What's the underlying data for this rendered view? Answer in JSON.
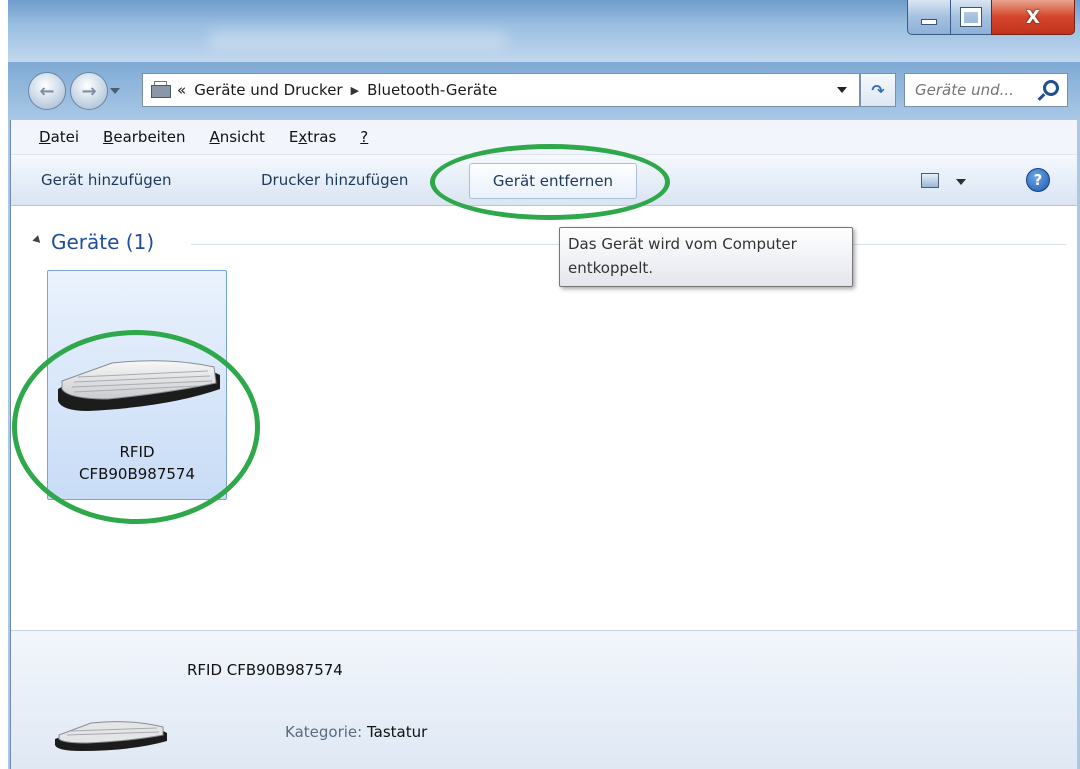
{
  "window": {
    "buttons": {
      "minimize": "minimize",
      "maximize": "maximize",
      "close": "X"
    }
  },
  "address_bar": {
    "prefix": "«",
    "breadcrumbs": [
      "Geräte und Drucker",
      "Bluetooth-Geräte"
    ],
    "search_placeholder": "Geräte und..."
  },
  "menu": {
    "items": [
      {
        "label": "Datei",
        "accel": "D",
        "rest": "atei"
      },
      {
        "label": "Bearbeiten",
        "accel": "B",
        "rest": "earbeiten"
      },
      {
        "label": "Ansicht",
        "accel": "A",
        "rest": "nsicht"
      },
      {
        "label": "Extras",
        "pre": "E",
        "accel": "x",
        "rest": "tras"
      },
      {
        "label": "?",
        "accel": "?",
        "rest": ""
      }
    ]
  },
  "toolbar": {
    "add_device": "Gerät hinzufügen",
    "add_printer": "Drucker hinzufügen",
    "remove_device": "Gerät entfernen",
    "help": "?"
  },
  "group": {
    "title": "Geräte (1)"
  },
  "device": {
    "name_line1": "RFID",
    "name_line2": "CFB90B987574",
    "icon": "keyboard-icon"
  },
  "tooltip": {
    "line1": "Das Gerät wird vom Computer",
    "line2": "entkoppelt."
  },
  "details": {
    "name": "RFID CFB90B987574",
    "category_key": "Kategorie:",
    "category_value": "Tastatur"
  },
  "colors": {
    "annotation": "#2ea84a",
    "group_title": "#1e4e9d",
    "selection": "#c8dcf6"
  }
}
